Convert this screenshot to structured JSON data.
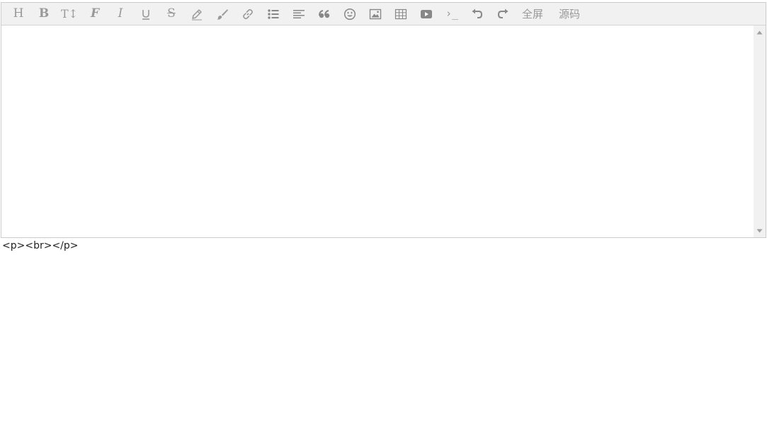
{
  "toolbar": {
    "heading": {
      "glyph": "H",
      "icon": "heading-icon"
    },
    "bold": {
      "glyph": "B",
      "icon": "bold-icon"
    },
    "font_size": {
      "glyph": "T↕",
      "icon": "font-size-icon"
    },
    "font_name": {
      "glyph": "F",
      "icon": "font-name-icon"
    },
    "italic": {
      "glyph": "I",
      "icon": "italic-icon"
    },
    "underline": {
      "icon": "underline-icon"
    },
    "strikethrough": {
      "glyph": "S",
      "icon": "strikethrough-icon"
    },
    "fore_color": {
      "icon": "pencil-icon"
    },
    "back_color": {
      "icon": "paint-brush-icon"
    },
    "link": {
      "icon": "link-icon"
    },
    "list": {
      "icon": "list-icon"
    },
    "justify": {
      "icon": "align-left-icon"
    },
    "quote": {
      "glyph": "66",
      "icon": "quote-icon"
    },
    "emoticon": {
      "icon": "smiley-icon"
    },
    "image": {
      "icon": "image-icon"
    },
    "table": {
      "icon": "table-icon"
    },
    "video": {
      "icon": "video-icon"
    },
    "code": {
      "glyph": "›_",
      "icon": "code-icon"
    },
    "undo": {
      "icon": "undo-icon"
    },
    "redo": {
      "icon": "redo-icon"
    },
    "fullscreen_label": "全屏",
    "source_label": "源码"
  },
  "source_output": "<p><br></p>",
  "colors": {
    "toolbar_bg": "#f1f1f1",
    "icon": "#999999",
    "border": "#cccccc"
  }
}
